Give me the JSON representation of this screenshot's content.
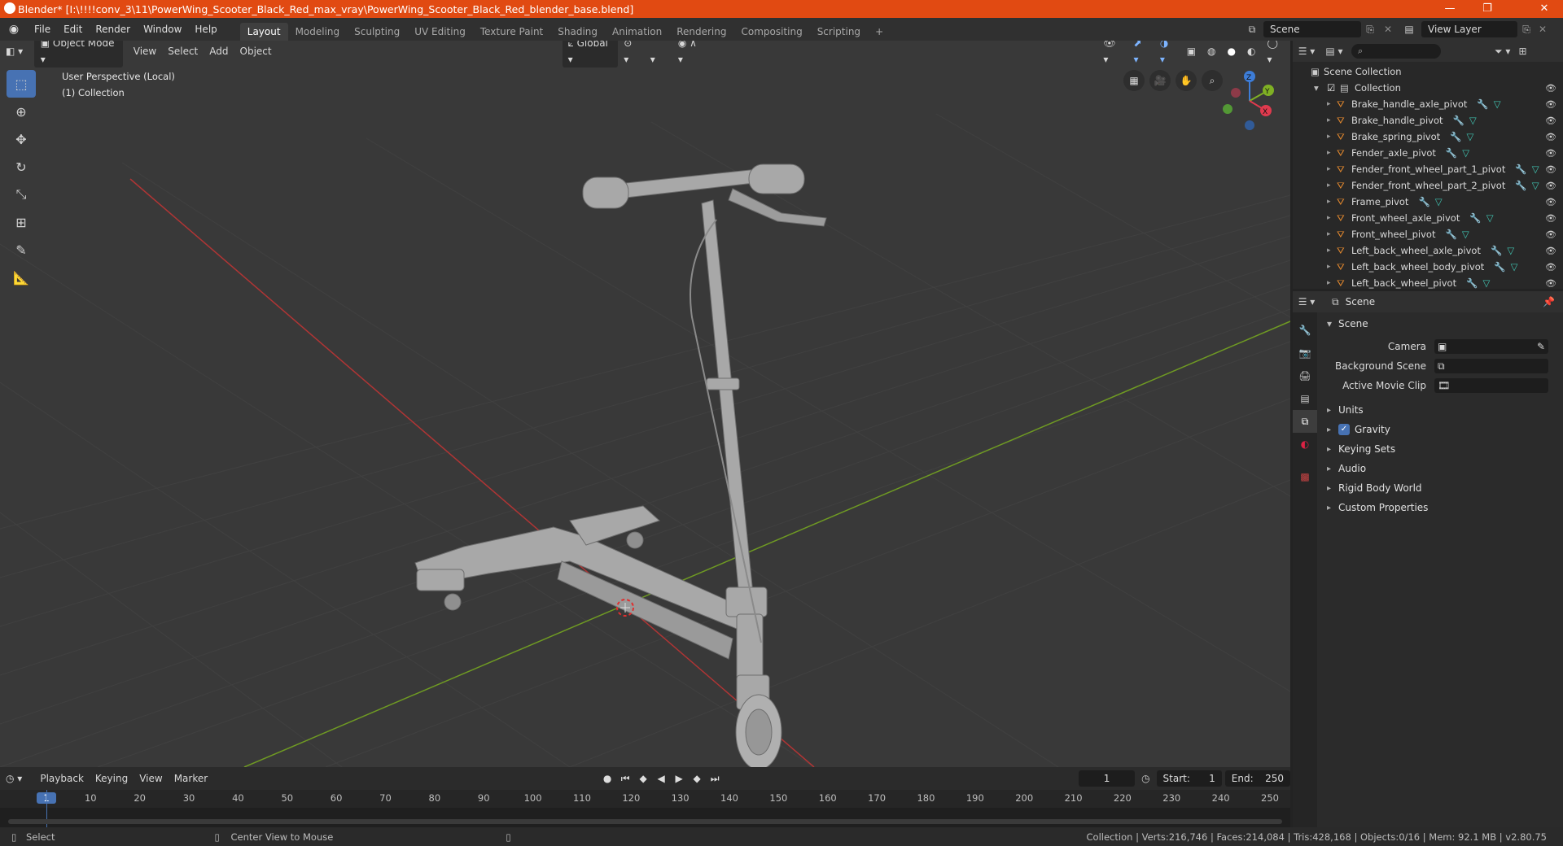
{
  "window": {
    "title": "Blender* [I:\\!!!!conv_3\\11\\PowerWing_Scooter_Black_Red_max_vray\\PowerWing_Scooter_Black_Red_blender_base.blend]",
    "minimize": "—",
    "maximize": "❐",
    "close": "✕"
  },
  "topbar": {
    "menus": [
      "File",
      "Edit",
      "Render",
      "Window",
      "Help"
    ],
    "workspaces": [
      "Layout",
      "Modeling",
      "Sculpting",
      "UV Editing",
      "Texture Paint",
      "Shading",
      "Animation",
      "Rendering",
      "Compositing",
      "Scripting"
    ],
    "active_workspace": "Layout",
    "add_tab": "+",
    "scene_name": "Scene",
    "view_layer": "View Layer"
  },
  "viewport": {
    "mode": "Object Mode",
    "menus": [
      "View",
      "Select",
      "Add",
      "Object"
    ],
    "orientation": "Global",
    "overlay_line1": "User Perspective (Local)",
    "overlay_line2": "(1) Collection",
    "gizmo": {
      "z": "Z",
      "y": "Y",
      "x": "X"
    }
  },
  "timeline": {
    "menus": [
      "Playback",
      "Keying",
      "View",
      "Marker"
    ],
    "current_frame": "1",
    "start_label": "Start:",
    "start": "1",
    "end_label": "End:",
    "end": "250",
    "ticks": [
      "1",
      "10",
      "20",
      "30",
      "40",
      "50",
      "60",
      "70",
      "80",
      "90",
      "100",
      "110",
      "120",
      "130",
      "140",
      "150",
      "160",
      "170",
      "180",
      "190",
      "200",
      "210",
      "220",
      "230",
      "240",
      "250"
    ]
  },
  "statusbar": {
    "left": "Select",
    "middle": "Center View to Mouse",
    "right": "Collection | Verts:216,746 | Faces:214,084 | Tris:428,168 | Objects:0/16 | Mem: 92.1 MB | v2.80.75"
  },
  "outliner": {
    "root": "Scene Collection",
    "collection": "Collection",
    "items": [
      "Brake_handle_axle_pivot",
      "Brake_handle_pivot",
      "Brake_spring_pivot",
      "Fender_axle_pivot",
      "Fender_front_wheel_part_1_pivot",
      "Fender_front_wheel_part_2_pivot",
      "Frame_pivot",
      "Front_wheel_axle_pivot",
      "Front_wheel_pivot",
      "Left_back_wheel_axle_pivot",
      "Left_back_wheel_body_pivot",
      "Left_back_wheel_pivot"
    ]
  },
  "properties": {
    "context": "Scene",
    "panel": "Scene",
    "camera_label": "Camera",
    "background_label": "Background Scene",
    "movieclip_label": "Active Movie Clip",
    "subpanels": [
      "Units",
      "Gravity",
      "Keying Sets",
      "Audio",
      "Rigid Body World",
      "Custom Properties"
    ]
  },
  "colors": {
    "title_accent": "#e14a12",
    "selection_blue": "#4772b3",
    "axis_x": "#b03535",
    "axis_y": "#6f9a23"
  }
}
